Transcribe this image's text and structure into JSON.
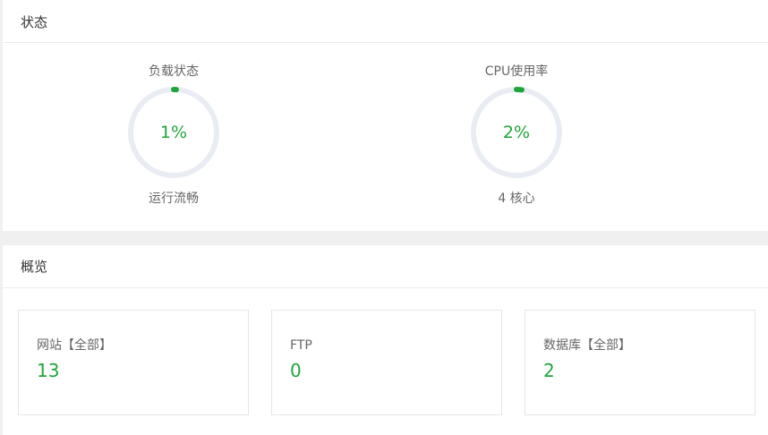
{
  "status": {
    "title": "状态",
    "gauges": [
      {
        "label": "负载状态",
        "value_text": "1%",
        "percent": 1,
        "sublabel": "运行流畅"
      },
      {
        "label": "CPU使用率",
        "value_text": "2%",
        "percent": 2,
        "sublabel": "4 核心"
      }
    ]
  },
  "overview": {
    "title": "概览",
    "cards": [
      {
        "label": "网站【全部】",
        "value": "13"
      },
      {
        "label": "FTP",
        "value": "0"
      },
      {
        "label": "数据库【全部】",
        "value": "2"
      }
    ]
  },
  "colors": {
    "accent": "#20a53a",
    "track": "#e9edf3"
  }
}
